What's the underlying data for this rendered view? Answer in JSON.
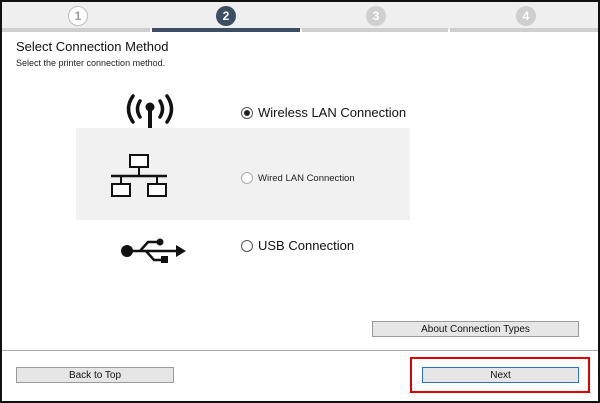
{
  "steps": [
    "1",
    "2",
    "3",
    "4"
  ],
  "header": {
    "title": "Select Connection Method",
    "subtitle": "Select the printer connection method."
  },
  "options": [
    {
      "label": "Wireless LAN Connection",
      "selected": true,
      "icon": "wireless-signal-icon"
    },
    {
      "label": "Wired LAN Connection",
      "selected": false,
      "icon": "network-topology-icon"
    },
    {
      "label": "USB Connection",
      "selected": false,
      "icon": "usb-icon"
    }
  ],
  "buttons": {
    "about": "About Connection Types",
    "back": "Back to Top",
    "next": "Next"
  },
  "colors": {
    "active_step": "#3b4e63",
    "inactive_step": "#cfcfcf",
    "highlight": "#e00000"
  }
}
